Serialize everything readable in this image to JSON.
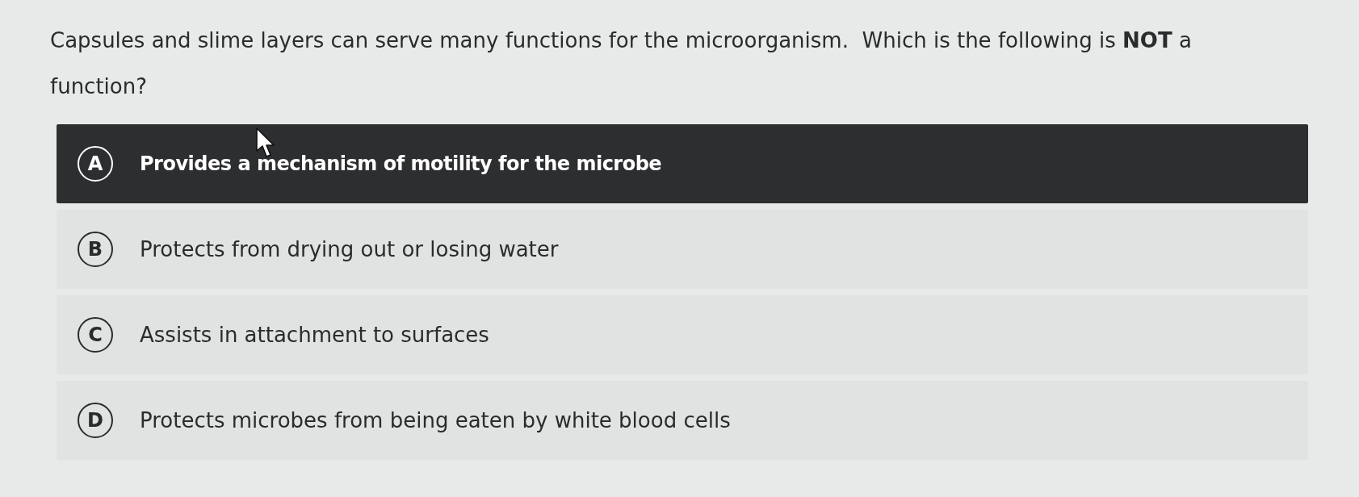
{
  "question": {
    "text": "Capsules and slime layers can serve many functions for the microorganism.  Which is the following is **NOT** a function?"
  },
  "options": [
    {
      "letter": "A",
      "text": "Provides a mechanism of motility for the microbe",
      "selected": true
    },
    {
      "letter": "B",
      "text": "Protects from drying out or losing water",
      "selected": false
    },
    {
      "letter": "C",
      "text": "Assists in attachment to surfaces",
      "selected": false
    },
    {
      "letter": "D",
      "text": "Protects microbes from being eaten by white blood cells",
      "selected": false
    }
  ]
}
